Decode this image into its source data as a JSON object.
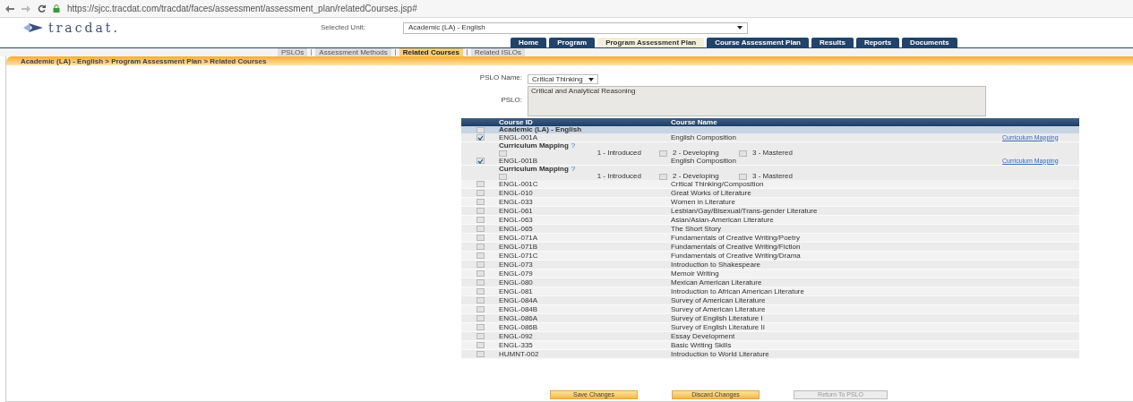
{
  "browser": {
    "url": "https://sjcc.tracdat.com/tracdat/faces/assessment/assessment_plan/relatedCourses.jsp#"
  },
  "header": {
    "logo": "tracdat.",
    "unit_label": "Selected Unit:",
    "unit_value": "Academic (LA) - English"
  },
  "nav_tabs": [
    {
      "label": "Home",
      "selected": false
    },
    {
      "label": "Program",
      "selected": false
    },
    {
      "label": "Program Assessment Plan",
      "selected": true
    },
    {
      "label": "Course Assessment Plan",
      "selected": false
    },
    {
      "label": "Results",
      "selected": false
    },
    {
      "label": "Reports",
      "selected": false
    },
    {
      "label": "Documents",
      "selected": false
    }
  ],
  "sub_tabs": [
    {
      "label": "PSLOs",
      "selected": false
    },
    {
      "label": "Assessment Methods",
      "selected": false
    },
    {
      "label": "Related Courses",
      "selected": true
    },
    {
      "label": "Related ISLOs",
      "selected": false
    }
  ],
  "breadcrumb": "Academic (LA) - English > Program Assessment Plan > Related Courses",
  "form": {
    "pslo_name_label": "PSLO Name:",
    "pslo_name_value": "Critical Thinking",
    "pslo_label": "PSLO:",
    "pslo_value": "Critical and Analytical Reasoning"
  },
  "table": {
    "columns": [
      "Course ID",
      "Course Name"
    ],
    "group": {
      "label": "Academic (LA) - English",
      "checked": false
    },
    "rows": [
      {
        "kind": "mapped",
        "course_id": "ENGL-001A",
        "course_name": "English Composition",
        "checked": true,
        "link": "Curriculum Mapping",
        "mapping_label": "Curriculum Mapping",
        "help": "?",
        "levels": [
          {
            "label": "1 - Introduced",
            "checked": false
          },
          {
            "label": "2 - Developing",
            "checked": false
          },
          {
            "label": "3 - Mastered",
            "checked": false
          }
        ]
      },
      {
        "kind": "mapped",
        "course_id": "ENGL-001B",
        "course_name": "English Composition",
        "checked": true,
        "link": "Curriculum Mapping",
        "mapping_label": "Curriculum Mapping",
        "help": "?",
        "levels": [
          {
            "label": "1 - Introduced",
            "checked": false
          },
          {
            "label": "2 - Developing",
            "checked": false
          },
          {
            "label": "3 - Mastered",
            "checked": false
          }
        ]
      },
      {
        "kind": "plain",
        "course_id": "ENGL-001C",
        "course_name": "Critical Thinking/Composition",
        "checked": false
      },
      {
        "kind": "plain",
        "course_id": "ENGL-010",
        "course_name": "Great Works of Literature",
        "checked": false
      },
      {
        "kind": "plain",
        "course_id": "ENGL-033",
        "course_name": "Women in Literature",
        "checked": false
      },
      {
        "kind": "plain",
        "course_id": "ENGL-061",
        "course_name": "Lesbian/Gay/Bisexual/Trans-gender Literature",
        "checked": false
      },
      {
        "kind": "plain",
        "course_id": "ENGL-063",
        "course_name": "Asian/Asian-American Literature",
        "checked": false
      },
      {
        "kind": "plain",
        "course_id": "ENGL-065",
        "course_name": "The Short Story",
        "checked": false
      },
      {
        "kind": "plain",
        "course_id": "ENGL-071A",
        "course_name": "Fundamentals of Creative Writing/Poetry",
        "checked": false
      },
      {
        "kind": "plain",
        "course_id": "ENGL-071B",
        "course_name": "Fundamentals of Creative Writing/Fiction",
        "checked": false
      },
      {
        "kind": "plain",
        "course_id": "ENGL-071C",
        "course_name": "Fundamentals of Creative Writing/Drama",
        "checked": false
      },
      {
        "kind": "plain",
        "course_id": "ENGL-073",
        "course_name": "Introduction to Shakespeare",
        "checked": false
      },
      {
        "kind": "plain",
        "course_id": "ENGL-079",
        "course_name": "Memoir Writing",
        "checked": false
      },
      {
        "kind": "plain",
        "course_id": "ENGL-080",
        "course_name": "Mexican American Literature",
        "checked": false
      },
      {
        "kind": "plain",
        "course_id": "ENGL-081",
        "course_name": "Introduction to African American Literature",
        "checked": false
      },
      {
        "kind": "plain",
        "course_id": "ENGL-084A",
        "course_name": "Survey of American Literature",
        "checked": false
      },
      {
        "kind": "plain",
        "course_id": "ENGL-084B",
        "course_name": "Survey of American Literature",
        "checked": false
      },
      {
        "kind": "plain",
        "course_id": "ENGL-086A",
        "course_name": "Survey of English Literature I",
        "checked": false
      },
      {
        "kind": "plain",
        "course_id": "ENGL-086B",
        "course_name": "Survey of English Literature II",
        "checked": false
      },
      {
        "kind": "plain",
        "course_id": "ENGL-092",
        "course_name": "Essay Development",
        "checked": false
      },
      {
        "kind": "plain",
        "course_id": "ENGL-335",
        "course_name": "Basic Writing Skills",
        "checked": false
      },
      {
        "kind": "plain",
        "course_id": "HUMNT-002",
        "course_name": "Introduction to World Literature",
        "checked": false
      }
    ]
  },
  "buttons": [
    {
      "label": "Save Changes",
      "kind": "primary"
    },
    {
      "label": "Discard Changes",
      "kind": "primary"
    },
    {
      "label": "Return To PSLO",
      "kind": "disabled"
    }
  ]
}
